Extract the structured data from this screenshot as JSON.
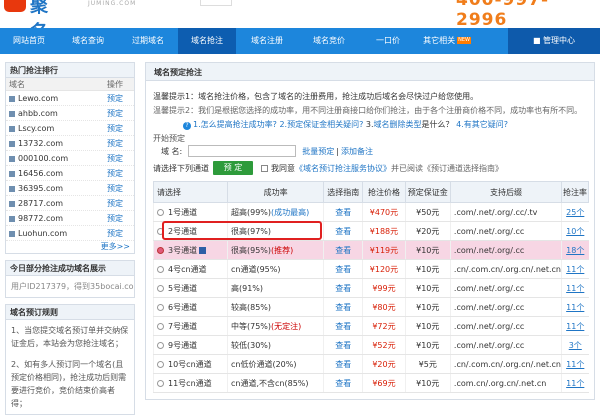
{
  "header": {
    "logo_text": "聚名",
    "domain_text": "JUMING.COM",
    "hotline": "400-997-2996"
  },
  "nav": {
    "items": [
      "网站首页",
      "域名查询",
      "过期域名",
      "域名抢注",
      "域名注册",
      "域名竞价",
      "一口价",
      "其它相关"
    ],
    "new_badge": "NEW",
    "manage": "管理中心",
    "active_index": 3
  },
  "sidebar": {
    "hot_title": "热门抢注排行",
    "col_domain": "域名",
    "col_action": "操作",
    "hot_items": [
      {
        "domain": "Lewo.com",
        "action": "预定"
      },
      {
        "domain": "ahbb.com",
        "action": "预定"
      },
      {
        "domain": "Lscy.com",
        "action": "预定"
      },
      {
        "domain": "13732.com",
        "action": "预定"
      },
      {
        "domain": "000100.com",
        "action": "预定"
      },
      {
        "domain": "16456.com",
        "action": "预定"
      },
      {
        "domain": "36395.com",
        "action": "预定"
      },
      {
        "domain": "28717.com",
        "action": "预定"
      },
      {
        "domain": "98772.com",
        "action": "预定"
      },
      {
        "domain": "Luohun.com",
        "action": "预定"
      }
    ],
    "more": "更多>>",
    "today_title": "今日部分抢注成功域名展示",
    "today_text": "用户ID217379，得到35bocai.com",
    "rules_title": "域名预订规则",
    "rules": [
      "1、当您提交域名预订单并交纳保证金后，本站会为您抢注域名；",
      "2、如有多人预订同一个域名(且预定价格相同)，抢注成功后则需要进行竞价，竞价结束价高者得；"
    ]
  },
  "main": {
    "title": "域名预定抢注",
    "tip1": "温馨提示1：域名抢注价格，包含了域名的注册费用，抢注成功后域名会尽快过户给您使用。",
    "tip2": "温馨提示2：我们是根据您选择的成功率，用不同注册商接口给你们抢注，由于各个注册商价格不同，成功率也有所不同。",
    "faq": {
      "q1": "1.怎么提高抢注成功率?",
      "q2": "2.预定保证金相关疑问?",
      "q3_prefix": "3.",
      "q3_link": "域名删除类型",
      "q3_suffix": "是什么？",
      "q4": "4.有其它疑问?"
    },
    "reg_legend": "开始预定",
    "domain_label": "域 名:",
    "bulk": "批量预定",
    "add_note": "添加备注",
    "select_label": "请选择下列通道",
    "reserve_btn": "预 定",
    "agree_prefix": "我同意",
    "agree_link": "《域名预订抢注服务协议》",
    "agree_suffix": "并已阅读《预订通道选择指南》",
    "columns": [
      "请选择",
      "成功率",
      "选择指南",
      "抢注价格",
      "预定保证金",
      "支持后缀",
      "抢注率"
    ],
    "rows": [
      {
        "channel": "1号通道",
        "rate": "超高(99%)",
        "rate_note": "(成功最高)",
        "guide": "查看",
        "price": "¥470元",
        "deposit": "¥50元",
        "suffix": ".com/.net/.org/.cc/.tv",
        "rob": "25个"
      },
      {
        "channel": "2号通道",
        "rate": "很高(97%)",
        "rate_note": "",
        "guide": "查看",
        "price": "¥188元",
        "deposit": "¥20元",
        "suffix": ".com/.net/.org/.cc",
        "rob": "10个"
      },
      {
        "channel": "3号通道",
        "rate": "很高(95%)",
        "rate_note": "(推荐)",
        "guide": "查看",
        "price": "¥119元",
        "deposit": "¥10元",
        "suffix": ".com/.net/.org/.cc",
        "rob": "18个"
      },
      {
        "channel": "4号cn通道",
        "rate": "cn通道(95%)",
        "rate_note": "",
        "guide": "查看",
        "price": "¥120元",
        "deposit": "¥10元",
        "suffix": ".cn/.com.cn/.org.cn/.net.cn",
        "rob": "11个"
      },
      {
        "channel": "5号通道",
        "rate": "高(91%)",
        "rate_note": "",
        "guide": "查看",
        "price": "¥99元",
        "deposit": "¥10元",
        "suffix": ".com/.net/.org/.cc",
        "rob": "11个"
      },
      {
        "channel": "6号通道",
        "rate": "较高(85%)",
        "rate_note": "",
        "guide": "查看",
        "price": "¥80元",
        "deposit": "¥10元",
        "suffix": ".com/.net/.org/.cc",
        "rob": "11个"
      },
      {
        "channel": "7号通道",
        "rate": "中等(75%)",
        "rate_note": "(无定注)",
        "guide": "查看",
        "price": "¥72元",
        "deposit": "¥10元",
        "suffix": ".com/.net/.org/.cc",
        "rob": "11个"
      },
      {
        "channel": "9号通道",
        "rate": "较低(30%)",
        "rate_note": "",
        "guide": "查看",
        "price": "¥52元",
        "deposit": "¥10元",
        "suffix": ".com/.net/.org/.cc",
        "rob": "3个"
      },
      {
        "channel": "10号cn通道",
        "rate": "cn低价通道(20%)",
        "rate_note": "",
        "guide": "查看",
        "price": "¥20元",
        "deposit": "¥5元",
        "suffix": ".cn/.com.cn/.org.cn/.net.cn",
        "rob": "11个"
      },
      {
        "channel": "11号cn通道",
        "rate": "cn通道,不含cn(85%)",
        "rate_note": "",
        "guide": "查看",
        "price": "¥69元",
        "deposit": "¥10元",
        "suffix": ".com.cn/.org.cn/.net.cn",
        "rob": "11个"
      }
    ],
    "selected_row": 2
  },
  "colors": {
    "nav": "#1d86dc",
    "nav_active": "#0d5db0",
    "hotline": "#f07d1b",
    "price": "#d81e06",
    "highlight_row": "#f7d6e4",
    "green_button": "#2e9b3b"
  }
}
